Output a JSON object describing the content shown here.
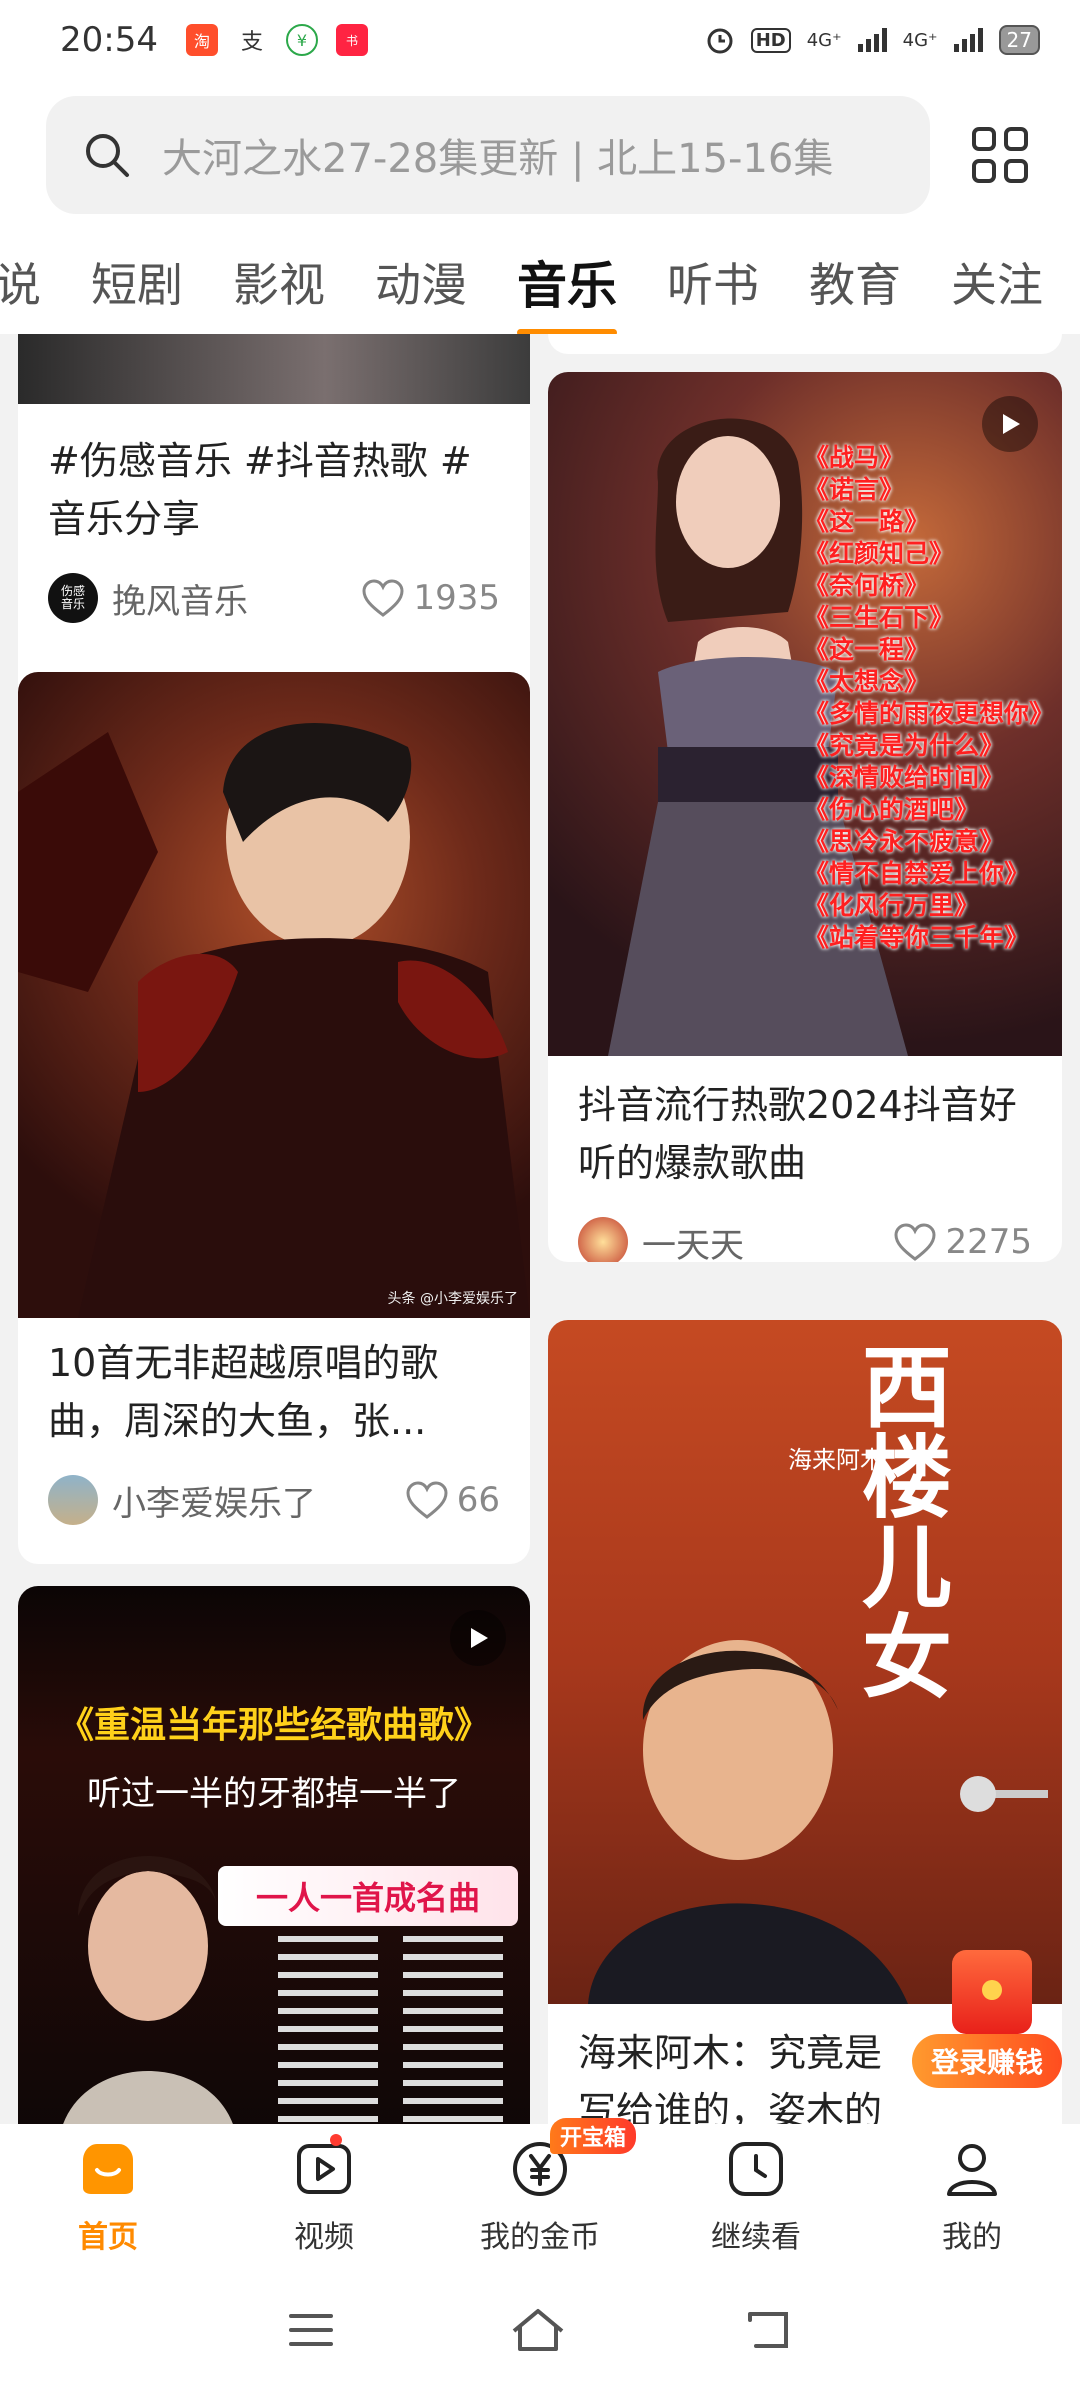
{
  "status": {
    "time": "20:54",
    "network_left": "4G⁺",
    "network_right": "4G⁺",
    "battery": "27",
    "hd": "HD",
    "app_icons": [
      "taobao-icon",
      "alipay-icon",
      "wechat-pay-icon",
      "xiaohongshu-icon"
    ]
  },
  "search": {
    "placeholder": "大河之水27-28集更新 | 北上15-16集"
  },
  "tabs": [
    {
      "label": "说"
    },
    {
      "label": "短剧"
    },
    {
      "label": "影视"
    },
    {
      "label": "动漫"
    },
    {
      "label": "音乐"
    },
    {
      "label": "听书"
    },
    {
      "label": "教育"
    },
    {
      "label": "关注"
    }
  ],
  "active_tab": "音乐",
  "cards": [
    {
      "title": "#伤感音乐 #抖音热歌 #音乐分享",
      "author": "挽风音乐",
      "likes": "1935",
      "avatar_text": "伤感音乐"
    },
    {
      "title": "10首无非超越原唱的歌曲，周深的大鱼，张...",
      "author": "小李爱娱乐了",
      "likes": "66",
      "watermark": "头条 @小李爱娱乐了"
    },
    {
      "title": "抖音流行热歌2024抖音好听的爆款歌曲",
      "author": "一天天",
      "likes": "2275",
      "songs": [
        "《战马》",
        "《诺言》",
        "《这一路》",
        "《红颜知己》",
        "《奈何桥》",
        "《三生石下》",
        "《这一程》",
        "《太想念》",
        "《多情的雨夜更想你》",
        "《究竟是为什么》",
        "《深情败给时间》",
        "《伤心的酒吧》",
        "《思冷永不疲意》",
        "《情不自禁爱上你》",
        "《化风行万里》",
        "《站着等你三千年》"
      ]
    },
    {
      "title": "海来阿木：究竟是写给谁的，姿木的宠儿还是大众",
      "poster_title": "西楼儿女",
      "poster_artist": "海来阿木"
    },
    {
      "poster_headline": "《重温当年那些经歌曲歌》",
      "poster_sub": "听过一半的牙都掉一半了",
      "poster_tag": "一人一首成名曲"
    }
  ],
  "float_badge": {
    "label": "登录赚钱"
  },
  "nav": [
    {
      "label": "首页",
      "icon": "home-icon"
    },
    {
      "label": "视频",
      "icon": "video-icon"
    },
    {
      "label": "我的金币",
      "icon": "coin-icon",
      "badge": "开宝箱"
    },
    {
      "label": "继续看",
      "icon": "clock-icon"
    },
    {
      "label": "我的",
      "icon": "profile-icon"
    }
  ],
  "colors": {
    "accent": "#ff8c00",
    "background": "#f2f2f2",
    "song_red": "#ff2020"
  }
}
